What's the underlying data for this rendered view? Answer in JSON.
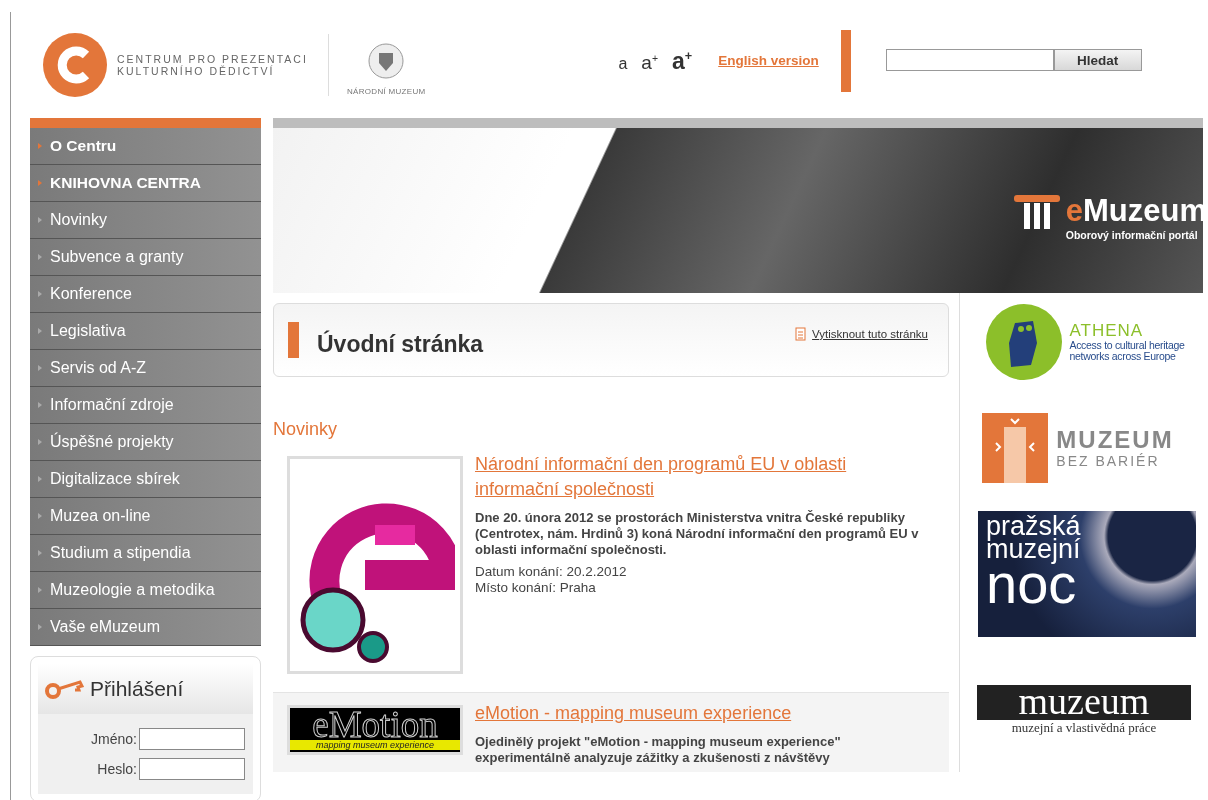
{
  "header": {
    "logo_lines": [
      "CENTRUM PRO PREZENTACI",
      "KULTURNÍHO DĚDICTVÍ"
    ],
    "partner_label": "NÁRODNÍ MUZEUM",
    "font_sizes": [
      {
        "label": "a",
        "kind": "small"
      },
      {
        "label": "a$^{+}$",
        "kind": "medium"
      },
      {
        "label": "a$^{+}$",
        "kind": "large"
      }
    ],
    "language_link": "English version",
    "search": {
      "button": "Hledat"
    }
  },
  "menu": [
    {
      "label": "O Centru",
      "kind": "main"
    },
    {
      "label": "KNIHOVNA CENTRA",
      "kind": "main"
    },
    {
      "label": "Novinky",
      "kind": "sub"
    },
    {
      "label": "Subvence a granty",
      "kind": "sub"
    },
    {
      "label": "Konference",
      "kind": "sub"
    },
    {
      "label": "Legislativa",
      "kind": "sub"
    },
    {
      "label": "Servis od A-Z",
      "kind": "sub"
    },
    {
      "label": "Informační zdroje",
      "kind": "sub"
    },
    {
      "label": "Úspěšné projekty",
      "kind": "sub"
    },
    {
      "label": "Digitalizace sbírek",
      "kind": "sub"
    },
    {
      "label": "Muzea on-line",
      "kind": "sub"
    },
    {
      "label": "Studium a stipendia",
      "kind": "sub"
    },
    {
      "label": "Muzeologie a metodika",
      "kind": "sub"
    },
    {
      "label": "Vaše eMuzeum",
      "kind": "sub"
    }
  ],
  "login": {
    "title": "Přihlášení",
    "fields": [
      {
        "label": "Jméno:"
      },
      {
        "label": "Heslo:"
      }
    ]
  },
  "banner": {
    "title_accent": "e",
    "title_rest": "Muzeum",
    "subtitle": "Oborový informační portál"
  },
  "page": {
    "title": "Úvodní stránka",
    "print_link": "Vytisknout tuto stránku",
    "section": "Novinky"
  },
  "articles": [
    {
      "kind": "poster",
      "title": "Národní informační den programů EU v oblasti informační společnosti",
      "summary": "Dne 20. února 2012 se prostorách Ministerstva vnitra České republiky (Centrotex, nám. Hrdinů 3) koná Národní informační den programů EU v oblasti informační společnosti.",
      "details": [
        "Datum konání: 20.2.2012",
        "Místo konání: Praha"
      ]
    },
    {
      "kind": "banner",
      "image_text": [
        "eMotion",
        "mapping museum experience"
      ],
      "title": "eMotion - mapping museum experience",
      "summary": "Ojedinělý projekt \"eMotion - mapping museum experience\" experimentálně analyzuje zážitky a zkušenosti z návštěvy"
    }
  ],
  "partners": [
    {
      "kind": "athena",
      "lines": [
        "ATHENA",
        "Access to cultural heritage",
        "networks across Europe"
      ]
    },
    {
      "kind": "barrier",
      "lines": [
        "MUZEUM",
        "BEZ BARIÉR"
      ]
    },
    {
      "kind": "night",
      "lines": [
        "pražská",
        "muzejní",
        "noc"
      ]
    },
    {
      "kind": "journal",
      "lines": [
        "muzeum",
        "muzejní a vlastivědná práce"
      ]
    }
  ]
}
